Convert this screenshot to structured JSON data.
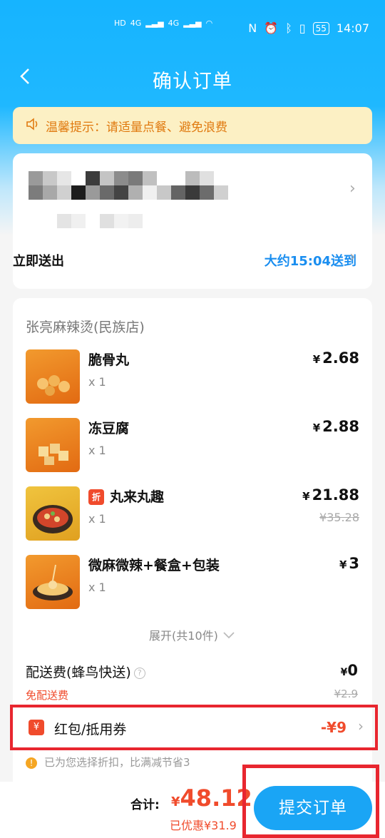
{
  "status_bar": {
    "signal_left": "HD",
    "net1": "4G",
    "net2": "4G",
    "battery": "55",
    "time": "14:07"
  },
  "nav": {
    "title": "确认订单",
    "back_icon": "chevron-left-icon"
  },
  "notice": {
    "text": "温馨提示：请适量点餐、避免浪费",
    "icon": "speaker-icon"
  },
  "delivery": {
    "label": "立即送出",
    "time": "大约15:04送到"
  },
  "shop": {
    "name": "张亮麻辣烫(民族店)",
    "items": [
      {
        "name": "脆骨丸",
        "qty": "x 1",
        "currency": "¥",
        "price": "2.68",
        "orig": "",
        "discount": "",
        "thumb": "#e97a1c"
      },
      {
        "name": "冻豆腐",
        "qty": "x 1",
        "currency": "¥",
        "price": "2.88",
        "orig": "",
        "discount": "",
        "thumb": "#f08a1e"
      },
      {
        "name": "丸来丸趣",
        "qty": "x 1",
        "currency": "¥",
        "price": "21.88",
        "orig": "¥35.28",
        "discount": "折",
        "thumb": "#e8b930"
      },
      {
        "name": "微麻微辣+餐盒+包装",
        "qty": "x 1",
        "currency": "¥",
        "price": "3",
        "orig": "",
        "discount": "",
        "thumb": "#e97a1c"
      }
    ],
    "expand": "展开(共10件)"
  },
  "fee": {
    "label": "配送费(蜂鸟快送)",
    "currency": "¥",
    "value": "0",
    "free_label": "免配送费",
    "orig": "¥2.9"
  },
  "coupon": {
    "icon": "¥",
    "label": "红包/抵用券",
    "value": "-¥9"
  },
  "hint": {
    "icon": "!",
    "text": "已为您选择折扣，比满减节省3"
  },
  "bottom": {
    "total_label": "合计:",
    "currency": "¥",
    "total": "48.12",
    "saved": "已优惠¥31.9",
    "submit": "提交订单"
  },
  "colors": {
    "accent_blue": "#1aa5f5",
    "price_red": "#f04b2c",
    "highlight_red": "#e8262f"
  }
}
